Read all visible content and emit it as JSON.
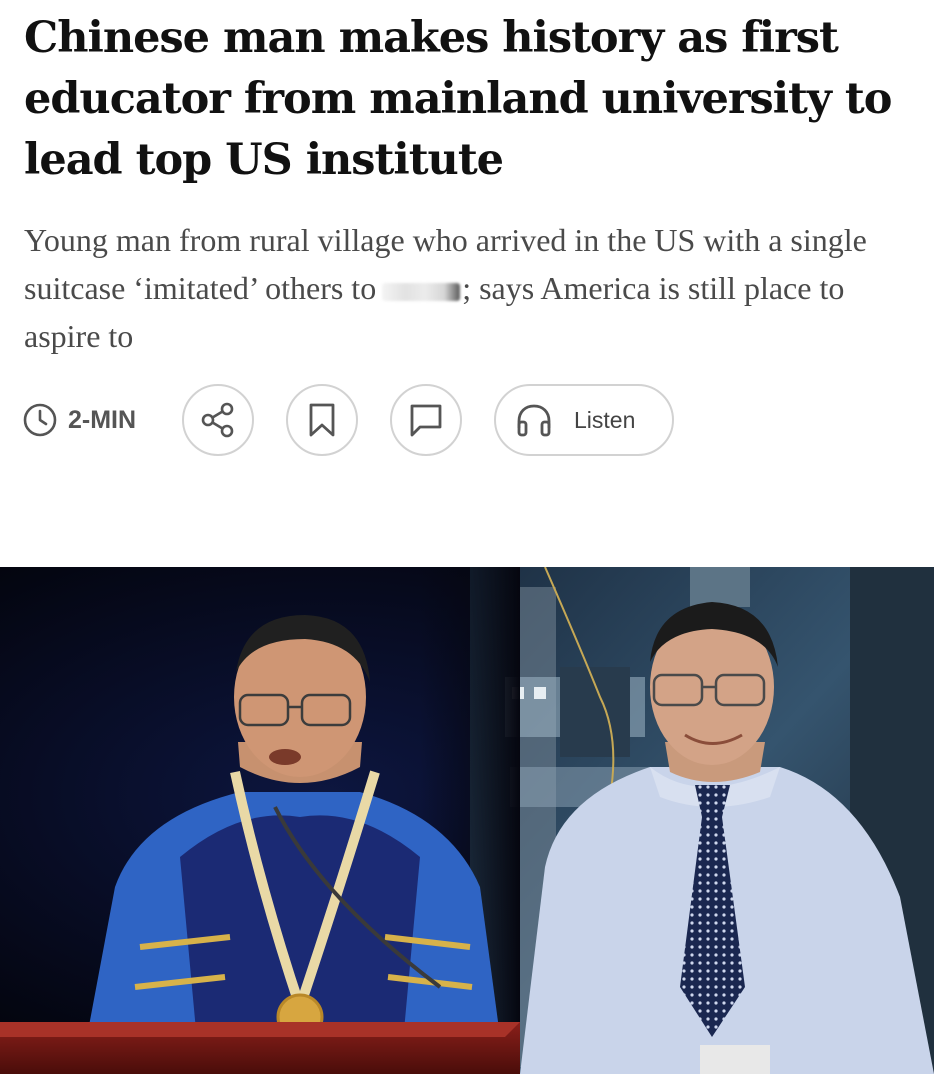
{
  "article": {
    "headline": "Chinese man makes history as first educator from mainland university to lead top US institute",
    "standfirst_part1": "Young man from rural village who arrived in the US with a single suitcase ‘imitated’ others to",
    "standfirst_part2": "; says America is still place to aspire to"
  },
  "toolbar": {
    "read_time": "2-MIN",
    "listen_label": "Listen",
    "icons": [
      "clock-icon",
      "share-icon",
      "bookmark-icon",
      "comment-icon",
      "headphones-icon"
    ]
  },
  "hero_image": {
    "description_alt": "Composite photo: man in academic regalia at podium and the same man in a lab wearing shirt and tie"
  },
  "colors": {
    "text_primary": "#111111",
    "text_secondary": "#4a4a4a",
    "icon_stroke": "#555555",
    "button_border": "#d2d2d2",
    "regalia_blue": "#2f64c4"
  }
}
